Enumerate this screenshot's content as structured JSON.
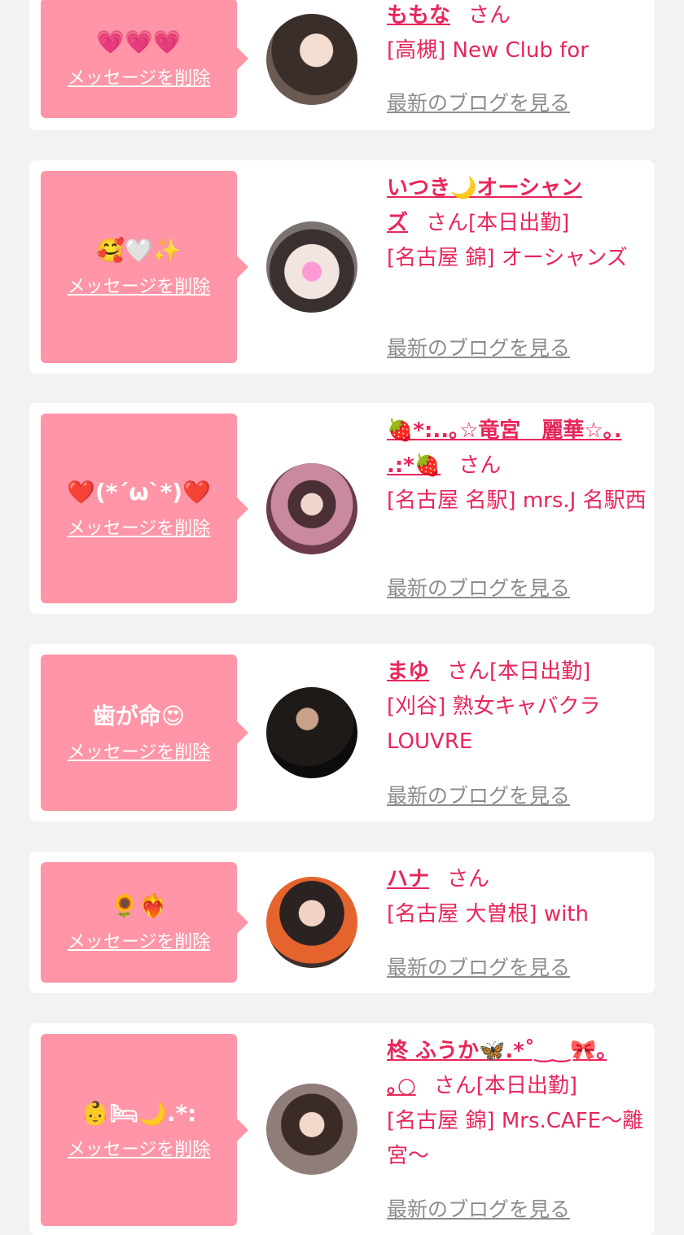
{
  "delete_label": "メッセージを削除",
  "blog_label": "最新のブログを見る",
  "san_label": "さん",
  "cards": [
    {
      "message": "💗💗💗",
      "name": "ももな",
      "status": "",
      "shop": "[高槻] New Club for"
    },
    {
      "message": "🥰🤍✨",
      "name_line1": "いつき🌙オーシャン",
      "name_line2": "ズ",
      "status": "[本日出勤]",
      "shop": "[名古屋 錦] オーシャンズ"
    },
    {
      "message": "❤️(*´ω`*)❤️",
      "name_line1": "🍓*:..｡☆竜宮　麗華☆｡.",
      "name_line2": ".:*🍓",
      "status": "",
      "shop": "[名古屋 名駅] mrs.J 名駅西"
    },
    {
      "message": "歯が命😍",
      "name": "まゆ",
      "status": "[本日出勤]",
      "shop": "[刈谷] 熟女キャバクラ LOUVRE"
    },
    {
      "message": "🌻❤️‍🔥",
      "name": "ハナ",
      "status": "",
      "shop": "[名古屋 大曽根] with"
    },
    {
      "message": "👶🛏🌙.*:",
      "name_line1": "柊 ふうか🦋.*˚‿‿🎀｡",
      "name_line2": "｡○",
      "status": "[本日出勤]",
      "shop": "[名古屋 錦] Mrs.CAFE〜離宮〜"
    }
  ]
}
